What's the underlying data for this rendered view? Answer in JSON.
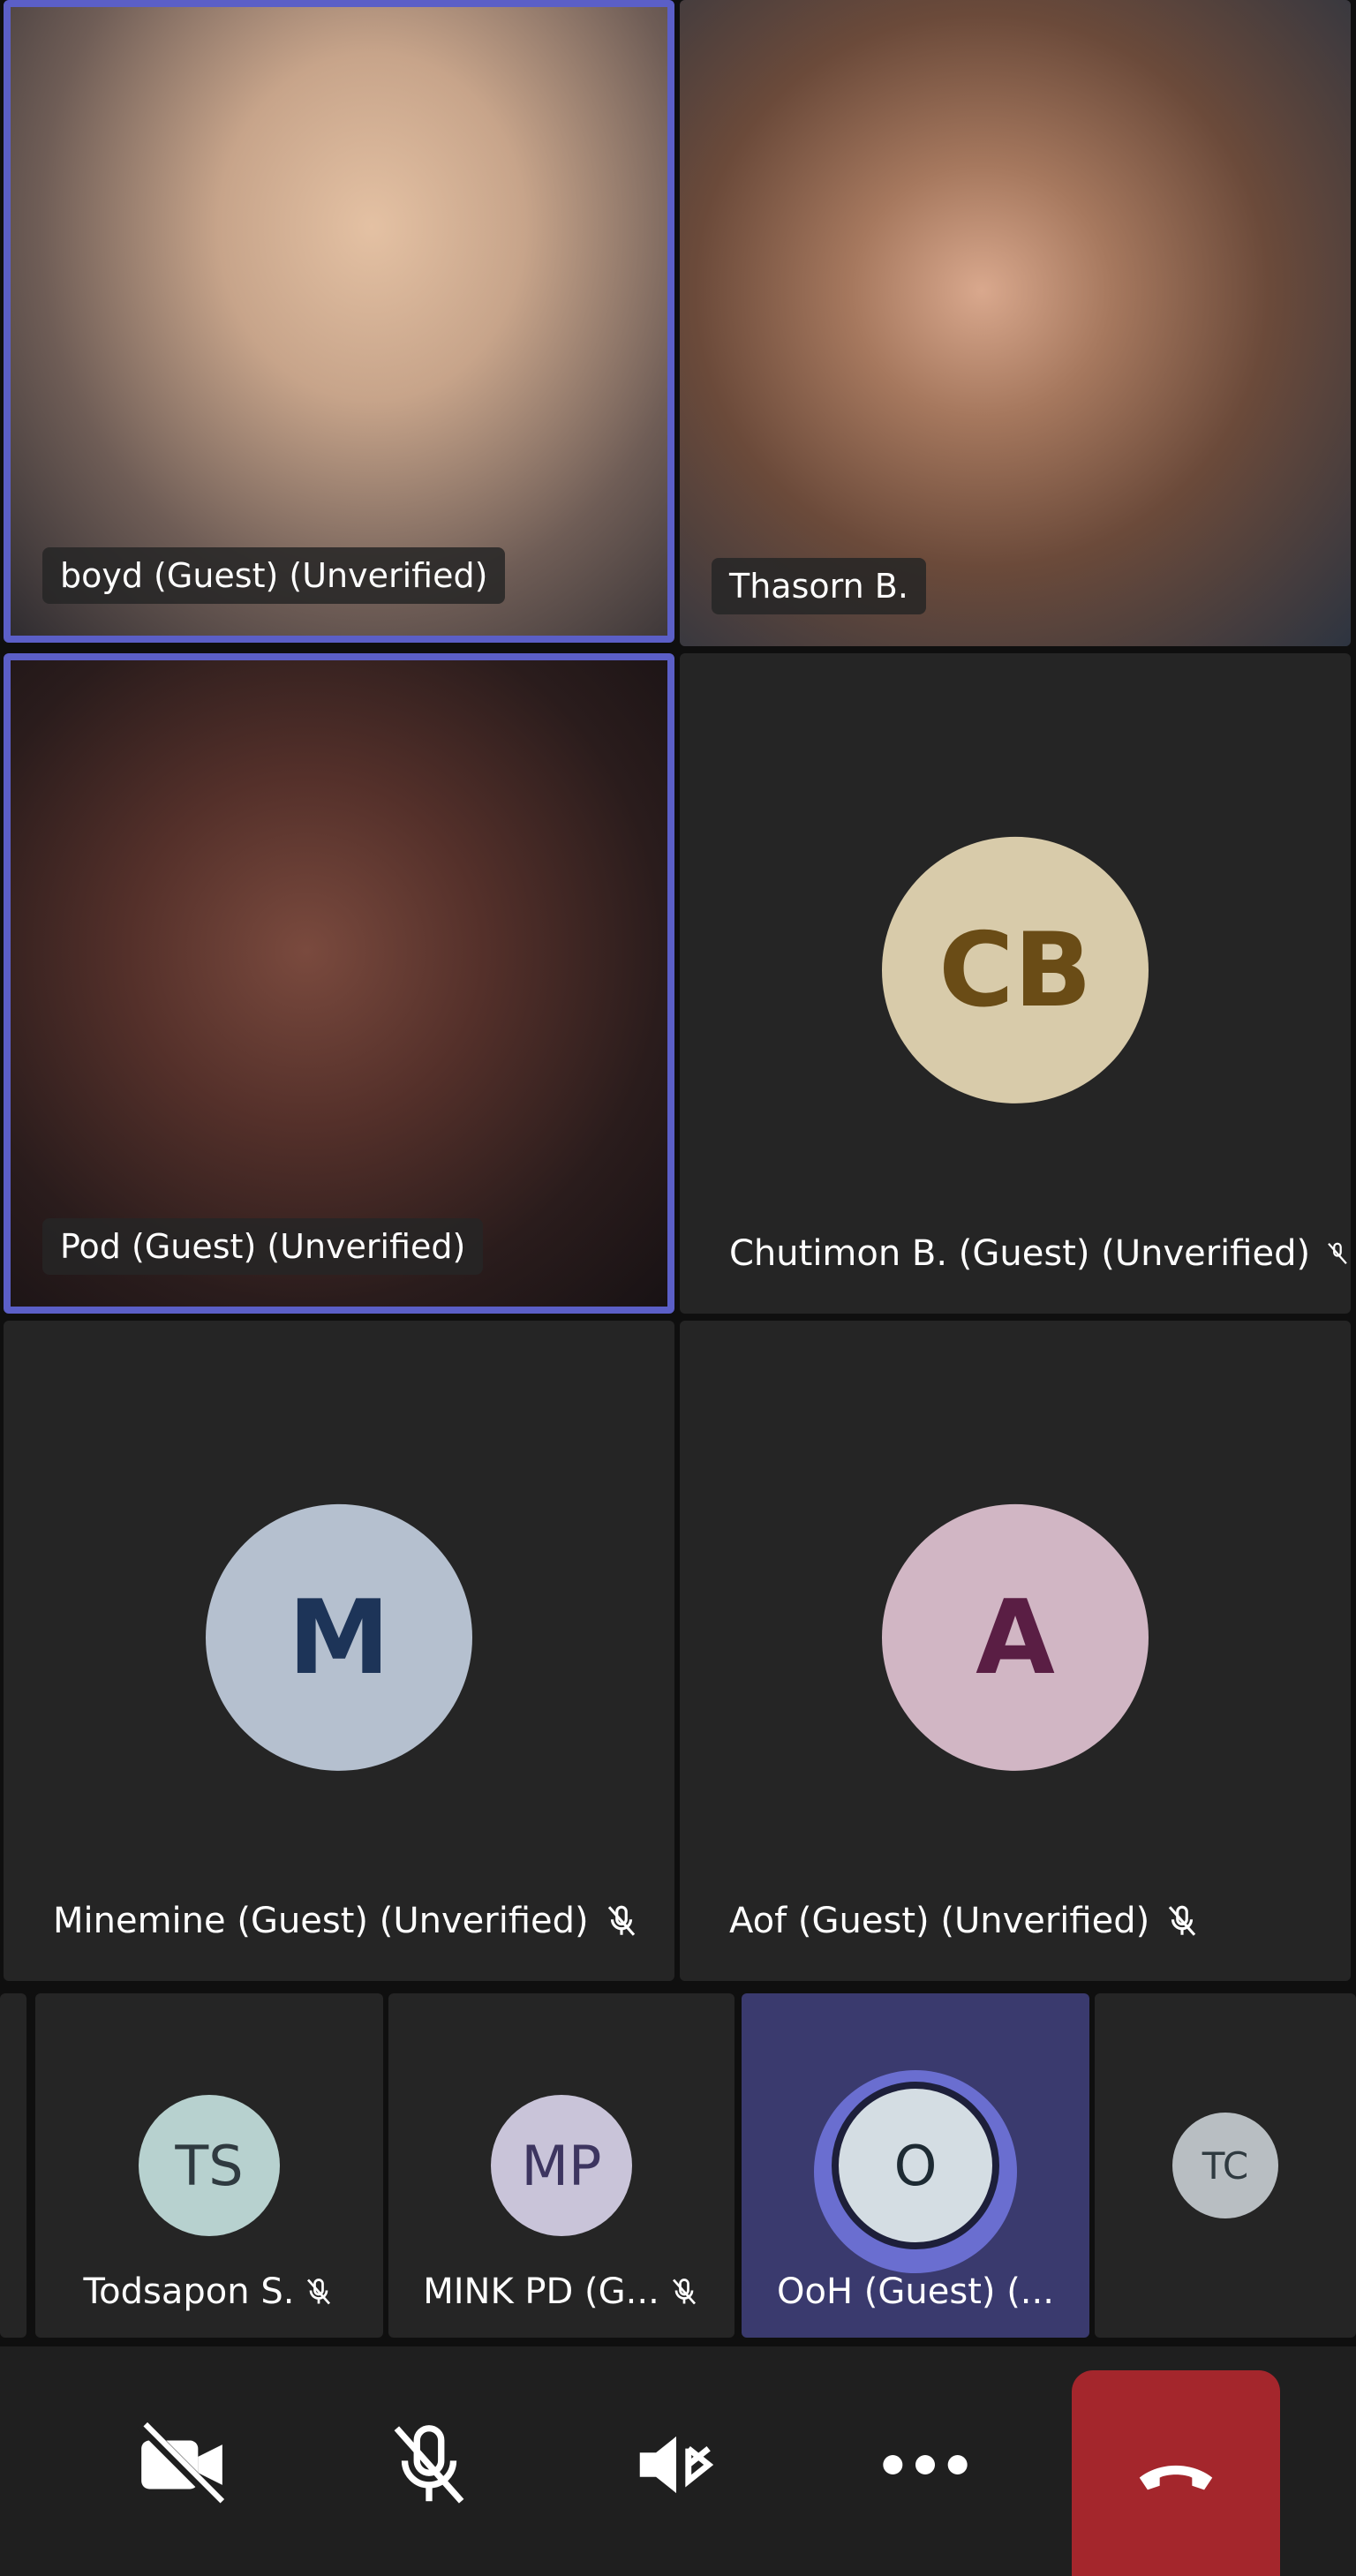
{
  "participants": {
    "main": [
      {
        "name": "boyd (Guest) (Unverified)",
        "video": true,
        "speaking": true
      },
      {
        "name": "Thasorn B.",
        "video": true,
        "speaking": false
      },
      {
        "name": "Pod (Guest) (Unverified)",
        "video": true,
        "speaking": true
      },
      {
        "name": "Chutimon B. (Guest) (Unverified)",
        "initials": "CB",
        "avatar_color": "#d8cbaa",
        "text_color": "#6a4c16",
        "muted": true
      },
      {
        "name": "Minemine (Guest) (Unverified)",
        "initials": "M",
        "avatar_color": "#b5c0cf",
        "text_color": "#1d3458",
        "muted": true
      },
      {
        "name": "Aof (Guest) (Unverified)",
        "initials": "A",
        "avatar_color": "#d1b6c4",
        "text_color": "#5a1e44",
        "muted": true
      }
    ],
    "strip": [
      {
        "name": "Todsapon S.",
        "initials": "TS",
        "avatar_color": "#b7d1cf",
        "muted": true
      },
      {
        "name": "MINK PD (G...",
        "initials": "MP",
        "avatar_color": "#c9c4d9",
        "muted": true
      },
      {
        "name": "OoH (Guest) (...",
        "initials": "O",
        "avatar_color": "#d4dde3",
        "active": true
      },
      {
        "name": "",
        "initials": "TC",
        "avatar_color": "#b8bec2"
      }
    ]
  },
  "colors": {
    "speaking_border": "#5b5fc7",
    "end_call": "#a4262c",
    "tile_bg": "#252525",
    "control_bar": "#1f1f1f"
  },
  "controls": [
    {
      "icon": "camera-off-icon"
    },
    {
      "icon": "mic-off-icon"
    },
    {
      "icon": "speaker-bluetooth-icon"
    },
    {
      "icon": "more-icon"
    },
    {
      "icon": "hang-up-icon"
    }
  ]
}
